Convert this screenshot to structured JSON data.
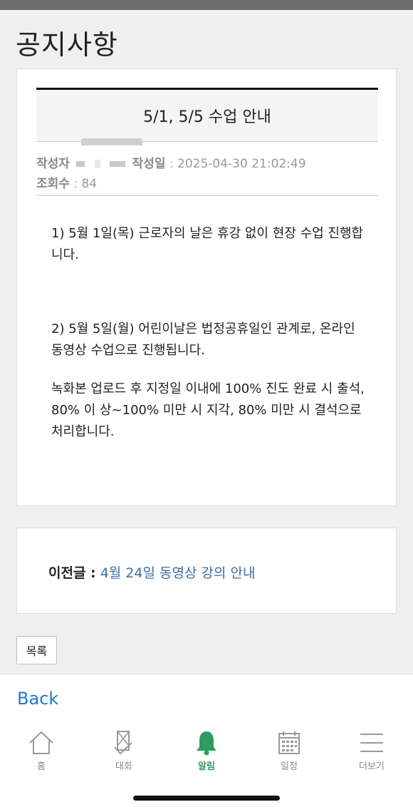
{
  "page": {
    "title": "공지사항"
  },
  "notice": {
    "subject": "5/1, 5/5 수업 안내",
    "author_label": "작성자",
    "date_label_partial": "작성일",
    "separator": ":",
    "date_value": "2025-04-30 21:02:49",
    "views_label": "조회수",
    "views_value": "84"
  },
  "body": {
    "paragraphs": [
      "1) 5월 1일(목) 근로자의 날은 휴강 없이 현장 수업 진행합니다.",
      "2) 5월 5일(월) 어린이날은 법정공휴일인 관계로, 온라인 동영상 수업으로 진행됩니다.",
      "녹화본 업로드 후 지정일 이내에 100% 진도 완료 시 출석, 80% 이 상~100% 미만 시 지각, 80% 미만 시 결석으로 처리합니다."
    ]
  },
  "prev_post": {
    "label": "이전글 :",
    "link_text": "4월 24일 동영상 강의 안내"
  },
  "list_button": {
    "label": "목록"
  },
  "nav": {
    "back_label": "Back",
    "tabs": [
      {
        "label": "홈",
        "icon": "home-icon"
      },
      {
        "label": "대화",
        "icon": "chat-icon"
      },
      {
        "label": "알림",
        "icon": "bell-icon",
        "active": true
      },
      {
        "label": "일정",
        "icon": "calendar-icon"
      },
      {
        "label": "더보기",
        "icon": "menu-icon"
      }
    ]
  },
  "colors": {
    "accent": "#2e9b5f",
    "link": "#3d6ea4",
    "back": "#1f78d1"
  }
}
